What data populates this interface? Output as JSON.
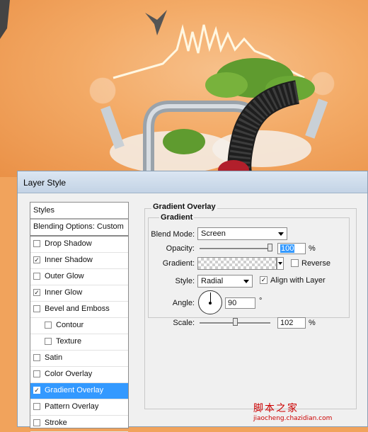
{
  "dialog": {
    "title": "Layer Style"
  },
  "style_list": {
    "header": "Styles",
    "blending": "Blending Options: Custom",
    "items": [
      {
        "label": "Drop Shadow",
        "checked": false,
        "sub": false,
        "selected": false
      },
      {
        "label": "Inner Shadow",
        "checked": true,
        "sub": false,
        "selected": false
      },
      {
        "label": "Outer Glow",
        "checked": false,
        "sub": false,
        "selected": false
      },
      {
        "label": "Inner Glow",
        "checked": true,
        "sub": false,
        "selected": false
      },
      {
        "label": "Bevel and Emboss",
        "checked": false,
        "sub": false,
        "selected": false
      },
      {
        "label": "Contour",
        "checked": false,
        "sub": true,
        "selected": false
      },
      {
        "label": "Texture",
        "checked": false,
        "sub": true,
        "selected": false
      },
      {
        "label": "Satin",
        "checked": false,
        "sub": false,
        "selected": false
      },
      {
        "label": "Color Overlay",
        "checked": false,
        "sub": false,
        "selected": false
      },
      {
        "label": "Gradient Overlay",
        "checked": true,
        "sub": false,
        "selected": true
      },
      {
        "label": "Pattern Overlay",
        "checked": false,
        "sub": false,
        "selected": false
      },
      {
        "label": "Stroke",
        "checked": false,
        "sub": false,
        "selected": false
      }
    ]
  },
  "panel": {
    "title": "Gradient Overlay",
    "group": "Gradient",
    "blend_mode_label": "Blend Mode:",
    "blend_mode_value": "Screen",
    "opacity_label": "Opacity:",
    "opacity_value": "100",
    "opacity_unit": "%",
    "opacity_level": 100,
    "gradient_label": "Gradient:",
    "reverse_label": "Reverse",
    "reverse_checked": false,
    "style_label": "Style:",
    "style_value": "Radial",
    "align_label": "Align with Layer",
    "align_checked": true,
    "angle_label": "Angle:",
    "angle_value": "90",
    "angle_unit": "°",
    "scale_label": "Scale:",
    "scale_value": "102",
    "scale_unit": "%",
    "scale_level": 102
  },
  "watermark": {
    "line1": "脚本之家",
    "line2": "jiaocheng.chazidian.com"
  }
}
